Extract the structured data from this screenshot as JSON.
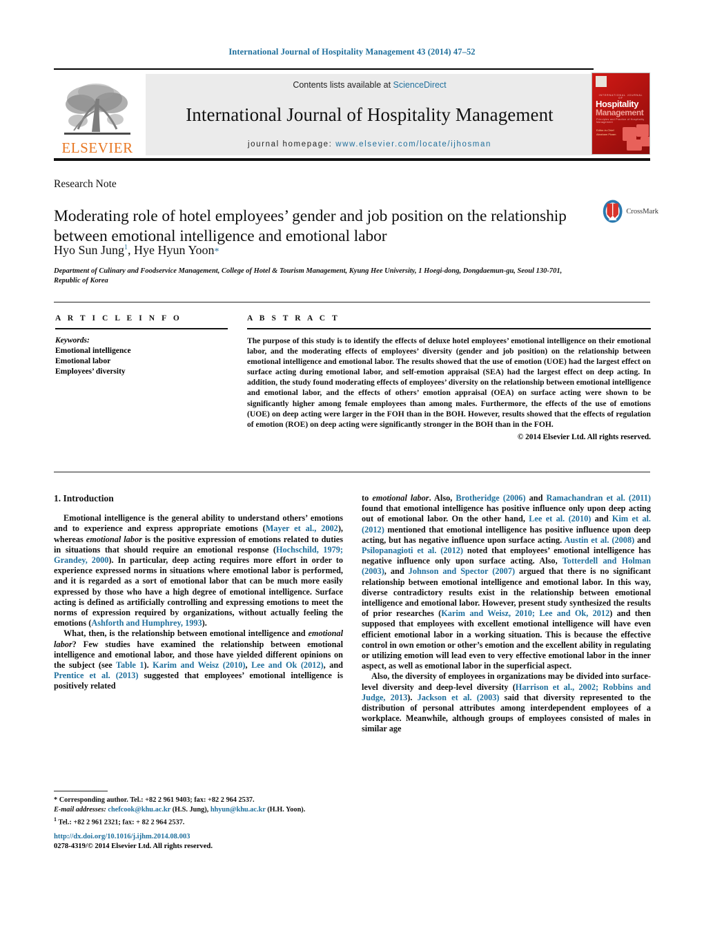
{
  "running_head": "International Journal of Hospitality Management 43 (2014) 47–52",
  "masthead": {
    "contents_prefix": "Contents lists available at ",
    "sciencedirect": "ScienceDirect",
    "journal_title": "International Journal of Hospitality Management",
    "homepage_prefix": "journal homepage:",
    "homepage_url": "www.elsevier.com/locate/ijhosman",
    "publisher": "ELSEVIER",
    "cover": {
      "pretitle": "INTERNATIONAL JOURNAL OF",
      "title_line1": "Hospitality",
      "title_line2": "Management",
      "subtitle": "Principles and Practice of Hospitality Management",
      "editor_label": "Editor-in-Chief",
      "editor_name": "Abraham Pizam"
    }
  },
  "article": {
    "doctype": "Research Note",
    "title": "Moderating role of hotel employees’ gender and job position on the relationship between emotional intelligence and emotional labor",
    "crossmark_label": "CrossMark",
    "author1": "Hyo Sun Jung",
    "author1_marker": "1",
    "author_sep": ", ",
    "author2": "Hye Hyun Yoon",
    "author2_marker": "*",
    "affiliation": "Department of Culinary and Foodservice Management, College of Hotel & Tourism Management, Kyung Hee University, 1 Hoegi-dong, Dongdaemun-gu, Seoul 130-701, Republic of Korea"
  },
  "article_info": {
    "heading": "A R T I C L E   I N F O",
    "keywords_label": "Keywords:",
    "keywords": [
      "Emotional intelligence",
      "Emotional labor",
      "Employees’ diversity"
    ]
  },
  "abstract": {
    "heading": "A B S T R A C T",
    "body": "The purpose of this study is to identify the effects of deluxe hotel employees’ emotional intelligence on their emotional labor, and the moderating effects of employees’ diversity (gender and job position) on the relationship between emotional intelligence and emotional labor. The results showed that the use of emotion (UOE) had the largest effect on surface acting during emotional labor, and self-emotion appraisal (SEA) had the largest effect on deep acting. In addition, the study found moderating effects of employees’ diversity on the relationship between emotional intelligence and emotional labor, and the effects of others’ emotion appraisal (OEA) on surface acting were shown to be significantly higher among female employees than among males. Furthermore, the effects of the use of emotions (UOE) on deep acting were larger in the FOH than in the BOH. However, results showed that the effects of regulation of emotion (ROE) on deep acting were significantly stronger in the BOH than in the FOH.",
    "copyright": "© 2014 Elsevier Ltd. All rights reserved."
  },
  "introduction": {
    "heading": "1.  Introduction",
    "left_paragraphs": [
      "Emotional intelligence is the general ability to understand others’ emotions and to experience and express appropriate emotions (Mayer et al., 2002), whereas emotional labor is the positive expression of emotions related to duties in situations that should require an emotional response (Hochschild, 1979; Grandey, 2000). In particular, deep acting requires more effort in order to experience expressed norms in situations where emotional labor is performed, and it is regarded as a sort of emotional labor that can be much more easily expressed by those who have a high degree of emotional intelligence. Surface acting is defined as artificially controlling and expressing emotions to meet the norms of expression required by organizations, without actually feeling the emotions (Ashforth and Humphrey, 1993).",
      "What, then, is the relationship between emotional intelligence and emotional labor? Few studies have examined the relationship between emotional intelligence and emotional labor, and those have yielded different opinions on the subject (see Table 1). Karim and Weisz (2010), Lee and Ok (2012), and Prentice et al. (2013) suggested that employees’ emotional intelligence is positively related"
    ],
    "right_paragraphs": [
      "to emotional labor. Also, Brotheridge (2006) and Ramachandran et al. (2011) found that emotional intelligence has positive influence only upon deep acting out of emotional labor. On the other hand, Lee et al. (2010) and Kim et al. (2012) mentioned that emotional intelligence has positive influence upon deep acting, but has negative influence upon surface acting. Austin et al. (2008) and Psilopanagioti et al. (2012) noted that employees’ emotional intelligence has negative influence only upon surface acting. Also, Totterdell and Holman (2003), and Johnson and Spector (2007) argued that there is no significant relationship between emotional intelligence and emotional labor. In this way, diverse contradictory results exist in the relationship between emotional intelligence and emotional labor. However, present study synthesized the results of prior researches (Karim and Weisz, 2010; Lee and Ok, 2012) and then supposed that employees with excellent emotional intelligence will have even efficient emotional labor in a working situation. This is because the effective control in own emotion or other’s emotion and the excellent ability in regulating or utilizing emotion will lead even to very effective emotional labor in the inner aspect, as well as emotional labor in the superficial aspect.",
      "Also, the diversity of employees in organizations may be divided into surface-level diversity and deep-level diversity (Harrison et al., 2002; Robbins and Judge, 2013). Jackson et al. (2003) said that diversity represented to the distribution of personal attributes among interdependent employees of a workplace. Meanwhile, although groups of employees consisted of males in similar age"
    ]
  },
  "footnotes": {
    "corresponding": "* Corresponding author. Tel.: +82 2 961 9403; fax: +82 2 964 2537.",
    "email_label": "E-mail addresses:",
    "email1": "chefcook@khu.ac.kr",
    "email1_owner": "(H.S. Jung),",
    "email2": "hhyun@khu.ac.kr",
    "email2_owner": "(H.H. Yoon).",
    "note1_marker": "1",
    "note1": "Tel.: +82 2 961 2321; fax: + 82 2 964 2537."
  },
  "footer": {
    "doi": "http://dx.doi.org/10.1016/j.ijhm.2014.08.003",
    "issn_line": "0278-4319/© 2014 Elsevier Ltd. All rights reserved."
  },
  "colors": {
    "link_blue": "#1f6f9c",
    "elsevier_orange": "#E87722",
    "cover_red": "#b31310"
  }
}
